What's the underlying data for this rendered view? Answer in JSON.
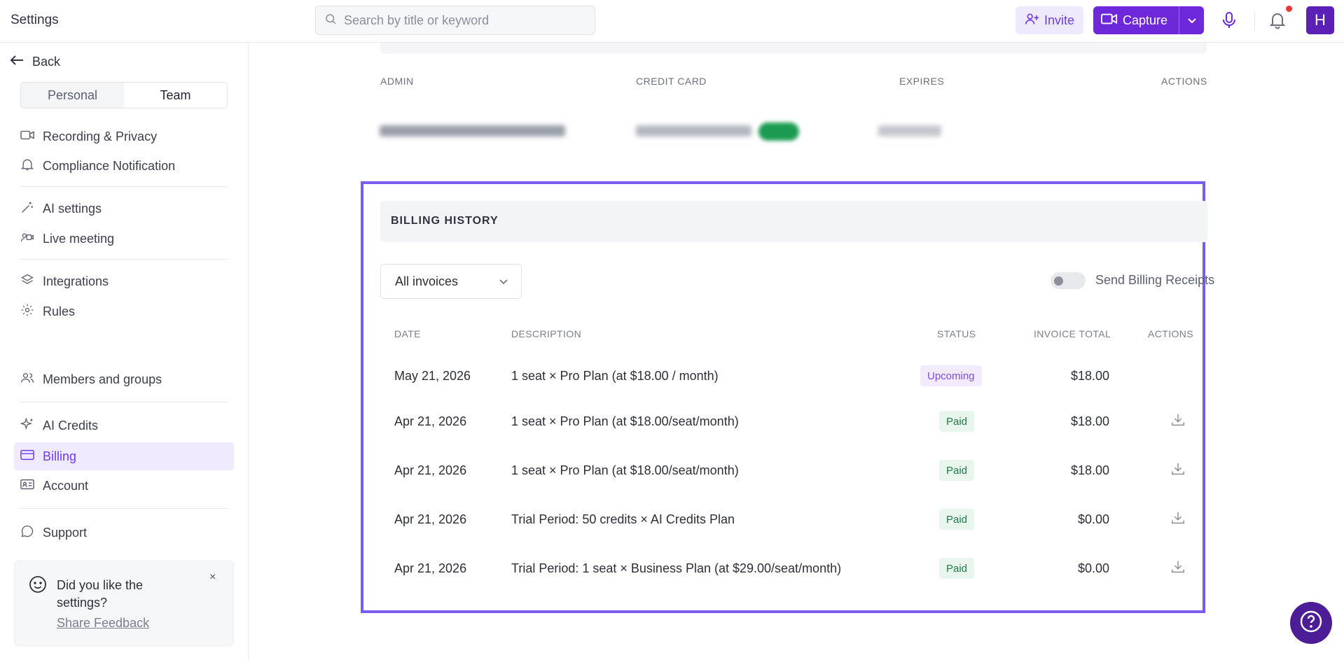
{
  "header": {
    "title": "Settings",
    "search_placeholder": "Search by title or keyword",
    "invite_label": "Invite",
    "capture_label": "Capture",
    "avatar_initial": "H"
  },
  "sidebar": {
    "back_label": "Back",
    "segments": {
      "personal": "Personal",
      "team": "Team"
    },
    "items": {
      "recording_privacy": "Recording & Privacy",
      "compliance": "Compliance Notification",
      "ai_settings": "AI settings",
      "live_meeting": "Live meeting",
      "integrations": "Integrations",
      "rules": "Rules",
      "members": "Members and groups",
      "ai_credits": "AI Credits",
      "billing": "Billing",
      "account": "Account",
      "support": "Support"
    },
    "feedback": {
      "question": "Did you like the settings?",
      "link": "Share Feedback",
      "close": "×"
    }
  },
  "payment_method": {
    "headers": {
      "admin": "ADMIN",
      "credit_card": "CREDIT CARD",
      "expires": "EXPIRES",
      "actions": "ACTIONS"
    }
  },
  "billing_history": {
    "title": "BILLING HISTORY",
    "filter_value": "All invoices",
    "send_receipts_label": "Send Billing Receipts",
    "send_receipts_on": false,
    "columns": {
      "date": "DATE",
      "description": "DESCRIPTION",
      "status": "STATUS",
      "total": "INVOICE TOTAL",
      "actions": "ACTIONS"
    },
    "rows": [
      {
        "date": "May 21, 2026",
        "description": "1 seat × Pro Plan (at $18.00 / month)",
        "status": "Upcoming",
        "total": "$18.00",
        "downloadable": false
      },
      {
        "date": "Apr 21, 2026",
        "description": "1 seat × Pro Plan (at $18.00/seat/month)",
        "status": "Paid",
        "total": "$18.00",
        "downloadable": true
      },
      {
        "date": "Apr 21, 2026",
        "description": "1 seat × Pro Plan (at $18.00/seat/month)",
        "status": "Paid",
        "total": "$18.00",
        "downloadable": true
      },
      {
        "date": "Apr 21, 2026",
        "description": "Trial Period: 50 credits × AI Credits Plan",
        "status": "Paid",
        "total": "$0.00",
        "downloadable": true
      },
      {
        "date": "Apr 21, 2026",
        "description": "Trial Period: 1 seat × Business Plan (at $29.00/seat/month)",
        "status": "Paid",
        "total": "$0.00",
        "downloadable": true
      }
    ]
  },
  "colors": {
    "accent": "#6d28d9",
    "highlight_border": "#7c5cf0",
    "paid": "#1d7a45",
    "upcoming": "#7c4ddf"
  },
  "icons": [
    "search-icon",
    "add-user-icon",
    "video-icon",
    "chevron-down-icon",
    "mic-icon",
    "bell-icon",
    "arrow-left-icon",
    "help-icon",
    "download-icon"
  ]
}
